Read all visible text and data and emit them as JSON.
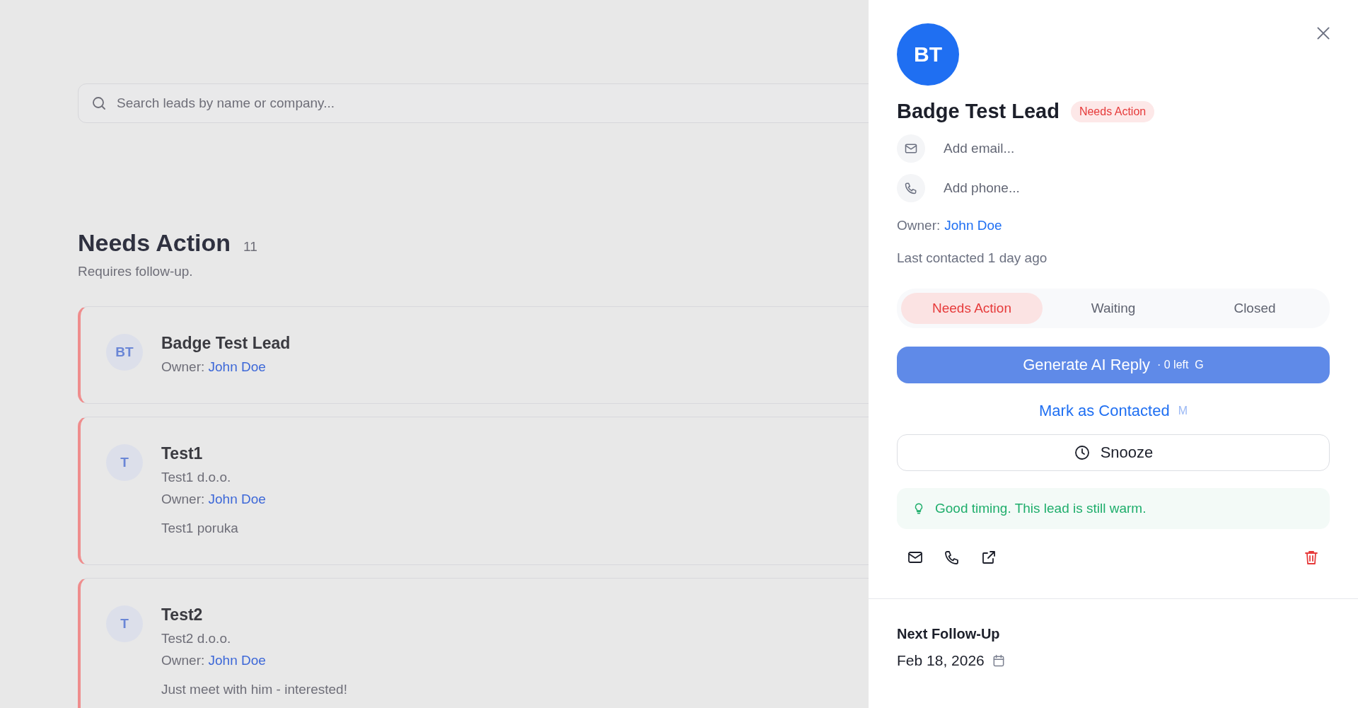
{
  "background": {
    "search": {
      "placeholder": "Search leads by name or company..."
    },
    "section": {
      "title": "Needs Action",
      "count": "11",
      "subtitle": "Requires follow-up."
    },
    "leads": [
      {
        "initials": "BT",
        "name": "Badge Test Lead",
        "owner_label": "Owner:",
        "owner": "John Doe"
      },
      {
        "initials": "T",
        "name": "Test1",
        "company": "Test1 d.o.o.",
        "owner_label": "Owner:",
        "owner": "John Doe",
        "note": "Test1 poruka"
      },
      {
        "initials": "T",
        "name": "Test2",
        "company": "Test2 d.o.o.",
        "owner_label": "Owner:",
        "owner": "John Doe",
        "note": "Just meet with him - interested!"
      }
    ]
  },
  "panel": {
    "initials": "BT",
    "name": "Badge Test Lead",
    "status_badge": "Needs Action",
    "email": {
      "placeholder": "Add email..."
    },
    "phone": {
      "placeholder": "Add phone..."
    },
    "owner_label": "Owner:",
    "owner": "John Doe",
    "last_contacted": "Last contacted 1 day ago",
    "status_tabs": [
      {
        "label": "Needs Action",
        "selected": true
      },
      {
        "label": "Waiting",
        "selected": false
      },
      {
        "label": "Closed",
        "selected": false
      }
    ],
    "generate_button": {
      "label": "Generate AI Reply",
      "remaining": "· 0 left",
      "shortcut": "G",
      "disabled": true
    },
    "mark_button": {
      "label": "Mark as Contacted",
      "shortcut": "M"
    },
    "snooze_button": {
      "label": "Snooze"
    },
    "tip": "Good timing. This lead is still warm.",
    "follow_up": {
      "title": "Next Follow-Up",
      "date": "Feb 18, 2026"
    }
  }
}
